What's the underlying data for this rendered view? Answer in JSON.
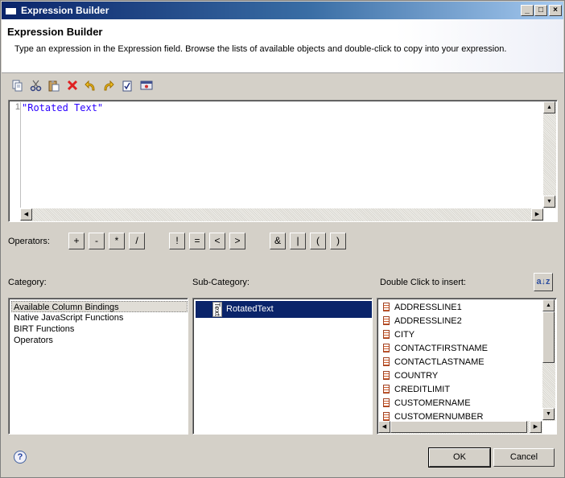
{
  "window": {
    "title": "Expression Builder",
    "controls": {
      "minimize": "_",
      "maximize": "□",
      "close": "×"
    }
  },
  "header": {
    "title": "Expression Builder",
    "description": "Type an expression in the Expression field. Browse the lists of available objects and double-click to copy into your expression."
  },
  "toolbar": {
    "icons": [
      "copy-icon",
      "cut-icon",
      "paste-icon",
      "delete-icon",
      "undo-icon",
      "redo-icon",
      "validate-icon",
      "calculate-icon"
    ]
  },
  "editor": {
    "line_number": "1",
    "code": "\"Rotated Text\""
  },
  "operators": {
    "label": "Operators:",
    "items": [
      "+",
      "-",
      "*",
      "/",
      "!",
      "=",
      "<",
      ">",
      "&",
      "|",
      "(",
      ")"
    ]
  },
  "category": {
    "label": "Category:",
    "items": [
      "Available Column Bindings",
      "Native JavaScript Functions",
      "BIRT Functions",
      "Operators"
    ],
    "selected": "Available Column Bindings"
  },
  "subcategory": {
    "label": "Sub-Category:",
    "icon_text": "Text",
    "items": [
      "RotatedText"
    ]
  },
  "insert": {
    "label": "Double Click to insert:",
    "items": [
      "ADDRESSLINE1",
      "ADDRESSLINE2",
      "CITY",
      "CONTACTFIRSTNAME",
      "CONTACTLASTNAME",
      "COUNTRY",
      "CREDITLIMIT",
      "CUSTOMERNAME",
      "CUSTOMERNUMBER"
    ]
  },
  "buttons": {
    "ok": "OK",
    "cancel": "Cancel",
    "help": "?",
    "sort": "a↓z"
  }
}
